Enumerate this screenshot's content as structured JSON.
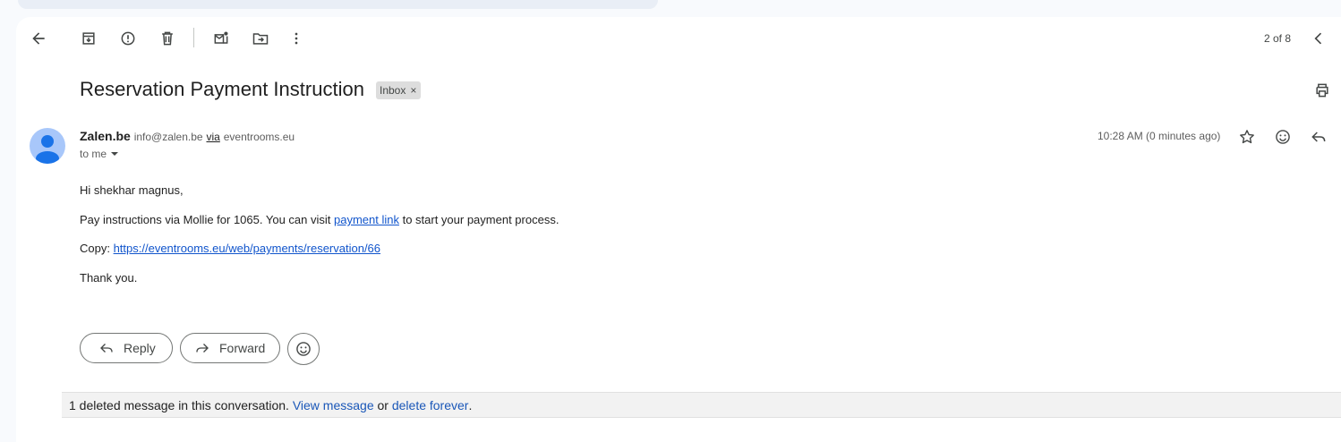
{
  "toolbar": {
    "pager": "2 of 8"
  },
  "message": {
    "subject": "Reservation Payment Instruction",
    "label": "Inbox",
    "label_remove": "×",
    "sender_name": "Zalen.be",
    "sender_email": "info@zalen.be",
    "via_label": "via",
    "via_domain": "eventrooms.eu",
    "recipient": "to me",
    "timestamp": "10:28 AM (0 minutes ago)",
    "greeting": "Hi shekhar magnus,",
    "line1_before": "Pay instructions via Mollie for 1065. You can visit ",
    "line1_link": "payment link",
    "line1_after": " to start your payment process.",
    "copy_label": "Copy: ",
    "copy_link": "https://eventrooms.eu/web/payments/reservation/66",
    "signoff": "Thank you."
  },
  "actions": {
    "reply": "Reply",
    "forward": "Forward"
  },
  "deleted_notice": {
    "text": "1 deleted message in this conversation. ",
    "view_link": "View message",
    "or": " or ",
    "delete_link": "delete forever",
    "end": "."
  },
  "colors": {
    "link": "#1155cc",
    "avatar_bg": "#a8c7fa",
    "avatar_fg": "#1a73e8"
  },
  "icons": [
    "back-arrow-icon",
    "archive-icon",
    "report-spam-icon",
    "delete-icon",
    "mark-unread-icon",
    "move-to-icon",
    "more-vert-icon",
    "chevron-left-icon",
    "print-icon",
    "star-icon",
    "emoji-icon",
    "reply-icon",
    "forward-icon",
    "dropdown-arrow-icon"
  ]
}
